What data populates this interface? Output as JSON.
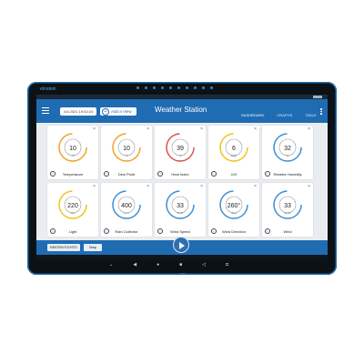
{
  "brand": "eInstein",
  "app": {
    "title": "Weather Station",
    "date": "4.6.2021 19:02:24",
    "add_view": "Add a View",
    "tabs": [
      "DASHBOARD",
      "GRAPHS",
      "TABLE"
    ],
    "active_tab": "DASHBOARD"
  },
  "widgets": [
    {
      "label": "Temperature",
      "value": "10",
      "unit": "°C",
      "ring": "#f0a12b"
    },
    {
      "label": "Dew Point",
      "value": "10",
      "unit": "°C",
      "ring": "#f0a12b"
    },
    {
      "label": "Heat Index",
      "value": "39",
      "unit": "°C",
      "ring": "#d9534f"
    },
    {
      "label": "UVI",
      "value": "6",
      "unit": "High",
      "ring": "#f0c419"
    },
    {
      "label": "Relative Humidity",
      "value": "32",
      "unit": "%",
      "ring": "#3b8fd6"
    },
    {
      "label": "Light",
      "value": "220",
      "unit": "klx",
      "ring": "#f0c419"
    },
    {
      "label": "Rain Collector",
      "value": "400",
      "unit": "mm",
      "ring": "#3b8fd6"
    },
    {
      "label": "Wind Speed",
      "value": "33",
      "unit": "km/h",
      "ring": "#3b8fd6"
    },
    {
      "label": "Wind Direction",
      "value": "260°",
      "unit": "deg",
      "ring": "#3b8fd6"
    },
    {
      "label": "Wind",
      "value": "33",
      "unit": "km/h",
      "ring": "#3b8fd6"
    }
  ],
  "bottom": {
    "btn1": "EINSTEIN FLEXSTO",
    "btn2": "Setup"
  },
  "nav_icons": [
    "chevron-down-icon",
    "back-icon",
    "home-icon",
    "recents-icon",
    "volume-icon",
    "camera-icon"
  ]
}
